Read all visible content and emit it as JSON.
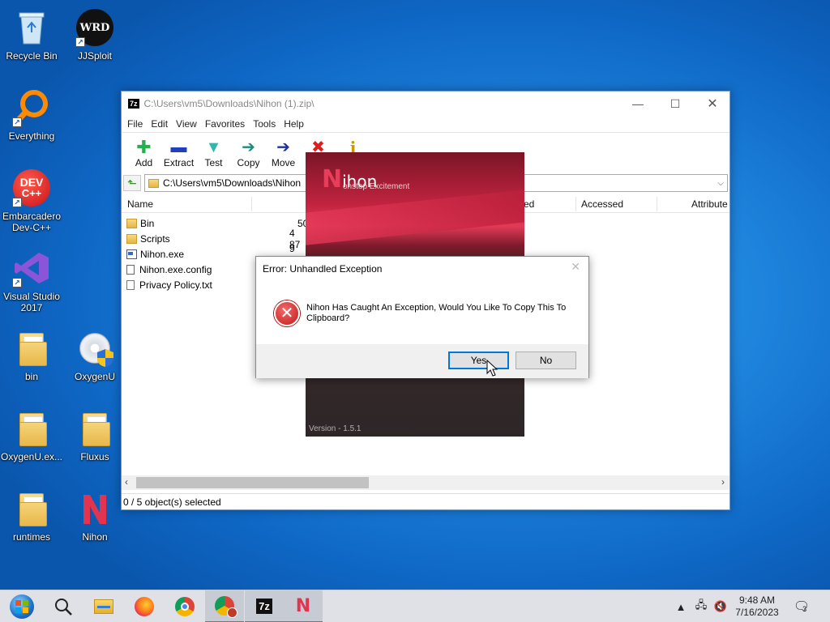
{
  "desktop": {
    "icons": [
      {
        "label": "Recycle Bin",
        "icon": "recycle-bin-icon"
      },
      {
        "label": "JJSploit",
        "icon": "jjsploit-icon"
      },
      {
        "label": "Everything",
        "icon": "everything-search-icon"
      },
      {
        "label": "Embarcadero Dev-C++",
        "icon": "devcpp-icon"
      },
      {
        "label": "Visual Studio 2017",
        "icon": "visual-studio-icon"
      },
      {
        "label": "bin",
        "icon": "folder-icon"
      },
      {
        "label": "OxygenU",
        "icon": "oxygenu-installer-icon"
      },
      {
        "label": "OxygenU.ex...",
        "icon": "folder-icon"
      },
      {
        "label": "Fluxus",
        "icon": "folder-icon"
      },
      {
        "label": "runtimes",
        "icon": "folder-icon"
      },
      {
        "label": "Nihon",
        "icon": "nihon-app-icon"
      }
    ],
    "jjsploit_badge": "WRD",
    "devcpp_badge_top": "DEV",
    "devcpp_badge_bottom": "C++"
  },
  "sevenzip": {
    "app_badge": "7z",
    "title": "C:\\Users\\vm5\\Downloads\\Nihon (1).zip\\",
    "menu": [
      "File",
      "Edit",
      "View",
      "Favorites",
      "Tools",
      "Help"
    ],
    "toolbar": [
      {
        "label": "Add",
        "icon": "add-icon",
        "glyph": "✚",
        "color": "#22b14c"
      },
      {
        "label": "Extract",
        "icon": "extract-icon",
        "glyph": "▬",
        "color": "#1f3fbf"
      },
      {
        "label": "Test",
        "icon": "test-icon",
        "glyph": "▼",
        "color": "#2fb7b0"
      },
      {
        "label": "Copy",
        "icon": "copy-icon",
        "glyph": "➔",
        "color": "#1f8a7a"
      },
      {
        "label": "Move",
        "icon": "move-icon",
        "glyph": "➔",
        "color": "#1f2f9f"
      },
      {
        "label": "D",
        "icon": "delete-icon",
        "glyph": "✖",
        "color": "#e01e1e"
      },
      {
        "label": "",
        "icon": "info-icon",
        "glyph": "i",
        "color": "#c89a00"
      }
    ],
    "address": "C:\\Users\\vm5\\Downloads\\Nihon",
    "columns": {
      "name": "Name",
      "modified_partial": "ed",
      "accessed": "Accessed",
      "attributes": "Attribute"
    },
    "files": [
      {
        "name": "Bin",
        "size": "50",
        "type": "folder"
      },
      {
        "name": "Scripts",
        "size": "4 87",
        "type": "folder"
      },
      {
        "name": "Nihon.exe",
        "size": "9 13",
        "type": "exe"
      },
      {
        "name": "Nihon.exe.config",
        "size": "",
        "type": "config"
      },
      {
        "name": "Privacy Policy.txt",
        "size": "",
        "type": "txt"
      }
    ],
    "status": "0 / 5 object(s) selected"
  },
  "splash": {
    "logo_letter": "N",
    "logo_text": "ihon",
    "subtitle": "onstop Excitement",
    "version": "Version - 1.5.1"
  },
  "dialog": {
    "title": "Error: Unhandled Exception",
    "close": "✕",
    "message": "Nihon Has Caught An Exception, Would You Like To Copy This To Clipboard?",
    "yes": "Yes",
    "no": "No"
  },
  "taskbar": {
    "apps": [
      "start-icon",
      "search-icon",
      "file-explorer-icon",
      "firefox-icon",
      "chrome-icon",
      "chrome-profile-icon",
      "7zip-icon",
      "nihon-taskbar-icon"
    ],
    "sevenzip_label": "7z",
    "nihon_label": "N",
    "time": "9:48 AM",
    "date": "7/16/2023",
    "notifications": "3"
  },
  "colors": {
    "desktop": "#1f86de",
    "taskbar": "#dfe1e7",
    "accent": "#0078d7"
  }
}
